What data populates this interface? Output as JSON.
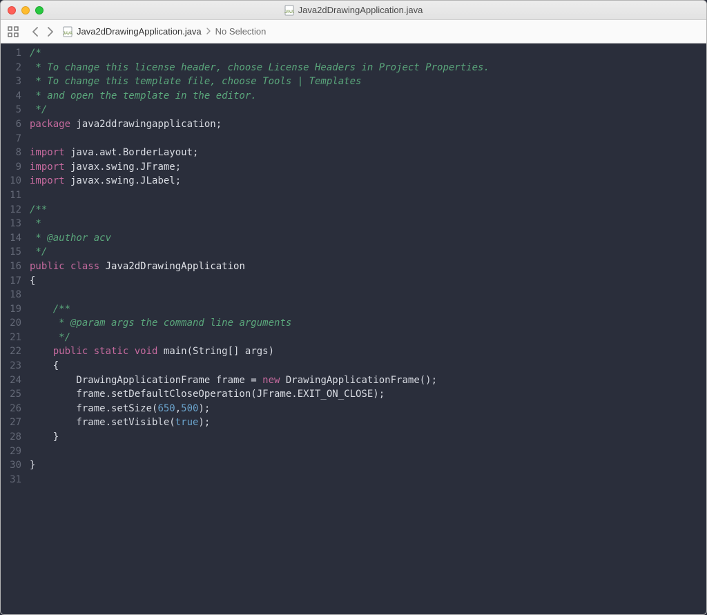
{
  "window": {
    "title": "Java2dDrawingApplication.java"
  },
  "toolbar": {
    "breadcrumb_file": "Java2dDrawingApplication.java",
    "breadcrumb_selection": "No Selection"
  },
  "code": {
    "lines": [
      [
        {
          "c": "c-comment",
          "t": "/*"
        }
      ],
      [
        {
          "c": "c-comment",
          "t": " * To change this license header, choose License Headers in Project Properties."
        }
      ],
      [
        {
          "c": "c-comment",
          "t": " * To change this template file, choose Tools | Templates"
        }
      ],
      [
        {
          "c": "c-comment",
          "t": " * and open the template in the editor."
        }
      ],
      [
        {
          "c": "c-comment",
          "t": " */"
        }
      ],
      [
        {
          "c": "c-keyword",
          "t": "package"
        },
        {
          "c": "c-text",
          "t": " java2ddrawingapplication;"
        }
      ],
      [],
      [
        {
          "c": "c-keyword",
          "t": "import"
        },
        {
          "c": "c-text",
          "t": " java.awt.BorderLayout;"
        }
      ],
      [
        {
          "c": "c-keyword",
          "t": "import"
        },
        {
          "c": "c-text",
          "t": " javax.swing.JFrame;"
        }
      ],
      [
        {
          "c": "c-keyword",
          "t": "import"
        },
        {
          "c": "c-text",
          "t": " javax.swing.JLabel;"
        }
      ],
      [],
      [
        {
          "c": "c-comment",
          "t": "/**"
        }
      ],
      [
        {
          "c": "c-comment",
          "t": " *"
        }
      ],
      [
        {
          "c": "c-comment",
          "t": " * @author acv"
        }
      ],
      [
        {
          "c": "c-comment",
          "t": " */"
        }
      ],
      [
        {
          "c": "c-keyword",
          "t": "public"
        },
        {
          "c": "c-text",
          "t": " "
        },
        {
          "c": "c-keyword",
          "t": "class"
        },
        {
          "c": "c-text",
          "t": " "
        },
        {
          "c": "c-type",
          "t": "Java2dDrawingApplication"
        }
      ],
      [
        {
          "c": "c-text",
          "t": "{"
        }
      ],
      [],
      [
        {
          "c": "c-text",
          "t": "    "
        },
        {
          "c": "c-comment",
          "t": "/**"
        }
      ],
      [
        {
          "c": "c-text",
          "t": "    "
        },
        {
          "c": "c-comment",
          "t": " * @param args the command line arguments"
        }
      ],
      [
        {
          "c": "c-text",
          "t": "    "
        },
        {
          "c": "c-comment",
          "t": " */"
        }
      ],
      [
        {
          "c": "c-text",
          "t": "    "
        },
        {
          "c": "c-keyword",
          "t": "public"
        },
        {
          "c": "c-text",
          "t": " "
        },
        {
          "c": "c-keyword",
          "t": "static"
        },
        {
          "c": "c-text",
          "t": " "
        },
        {
          "c": "c-keyword",
          "t": "void"
        },
        {
          "c": "c-text",
          "t": " main(String[] args)"
        }
      ],
      [
        {
          "c": "c-text",
          "t": "    {"
        }
      ],
      [
        {
          "c": "c-text",
          "t": "        DrawingApplicationFrame frame = "
        },
        {
          "c": "c-new",
          "t": "new"
        },
        {
          "c": "c-text",
          "t": " DrawingApplicationFrame();"
        }
      ],
      [
        {
          "c": "c-text",
          "t": "        frame.setDefaultCloseOperation(JFrame.EXIT_ON_CLOSE);"
        }
      ],
      [
        {
          "c": "c-text",
          "t": "        frame.setSize("
        },
        {
          "c": "c-number",
          "t": "650"
        },
        {
          "c": "c-text",
          "t": ","
        },
        {
          "c": "c-number",
          "t": "500"
        },
        {
          "c": "c-text",
          "t": ");"
        }
      ],
      [
        {
          "c": "c-text",
          "t": "        frame.setVisible("
        },
        {
          "c": "c-bool",
          "t": "true"
        },
        {
          "c": "c-text",
          "t": ");"
        }
      ],
      [
        {
          "c": "c-text",
          "t": "    }"
        }
      ],
      [],
      [
        {
          "c": "c-text",
          "t": "}"
        }
      ],
      []
    ]
  }
}
